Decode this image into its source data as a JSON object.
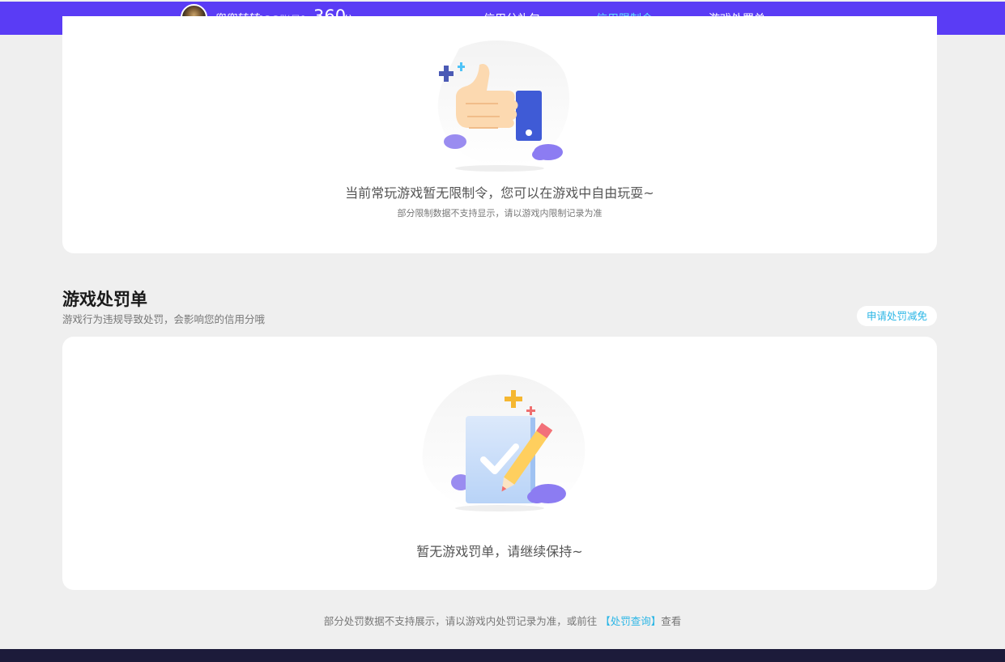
{
  "header": {
    "username": "兜兜转转",
    "account_type": "[QQ账号]",
    "score": "360",
    "score_unit": "分",
    "tabs": [
      {
        "label": "信用分礼包",
        "active": false
      },
      {
        "label": "信用限制令",
        "active": true
      },
      {
        "label": "游戏处罚单",
        "active": false
      }
    ]
  },
  "restriction": {
    "message": "当前常玩游戏暂无限制令，您可以在游戏中自由玩耍~",
    "note": "部分限制数据不支持显示，请以游戏内限制记录为准"
  },
  "penalty": {
    "title": "游戏处罚单",
    "description": "游戏行为违规导致处罚，会影响您的信用分哦",
    "apply_button": "申请处罚减免",
    "empty_message": "暂无游戏罚单，请继续保持~"
  },
  "footer": {
    "note_prefix": "部分处罚数据不支持展示，请以游戏内处罚记录为准，或前往",
    "link": "【处罚查询】",
    "note_suffix": "查看"
  },
  "colors": {
    "header_bg": "#5a3cf5",
    "active_tab": "#5fe0ff",
    "link": "#2ab6e6"
  }
}
